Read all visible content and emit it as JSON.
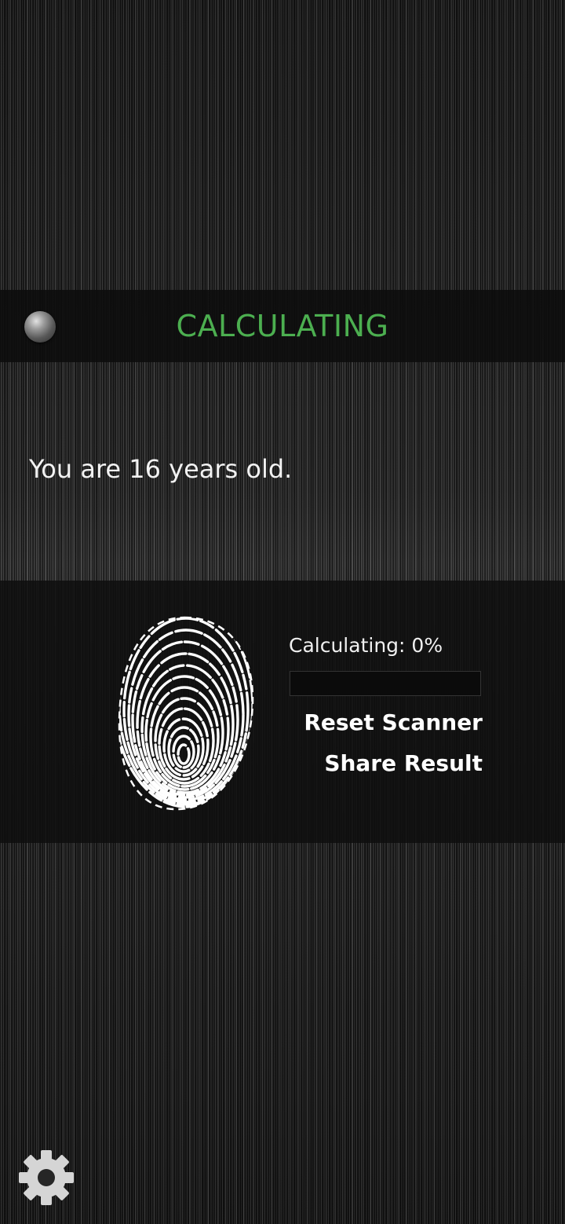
{
  "header": {
    "status_title": "CALCULATING",
    "status_color": "#4caf50"
  },
  "result": {
    "age_text": "You are 16 years old."
  },
  "scanner": {
    "progress_label": "Calculating: 0%",
    "progress_fraction": 0,
    "reset_label": "Reset Scanner",
    "share_label": "Share Result"
  },
  "icons": {
    "status": "status-led-icon",
    "fingerprint": "fingerprint-icon",
    "settings": "gear-icon"
  }
}
